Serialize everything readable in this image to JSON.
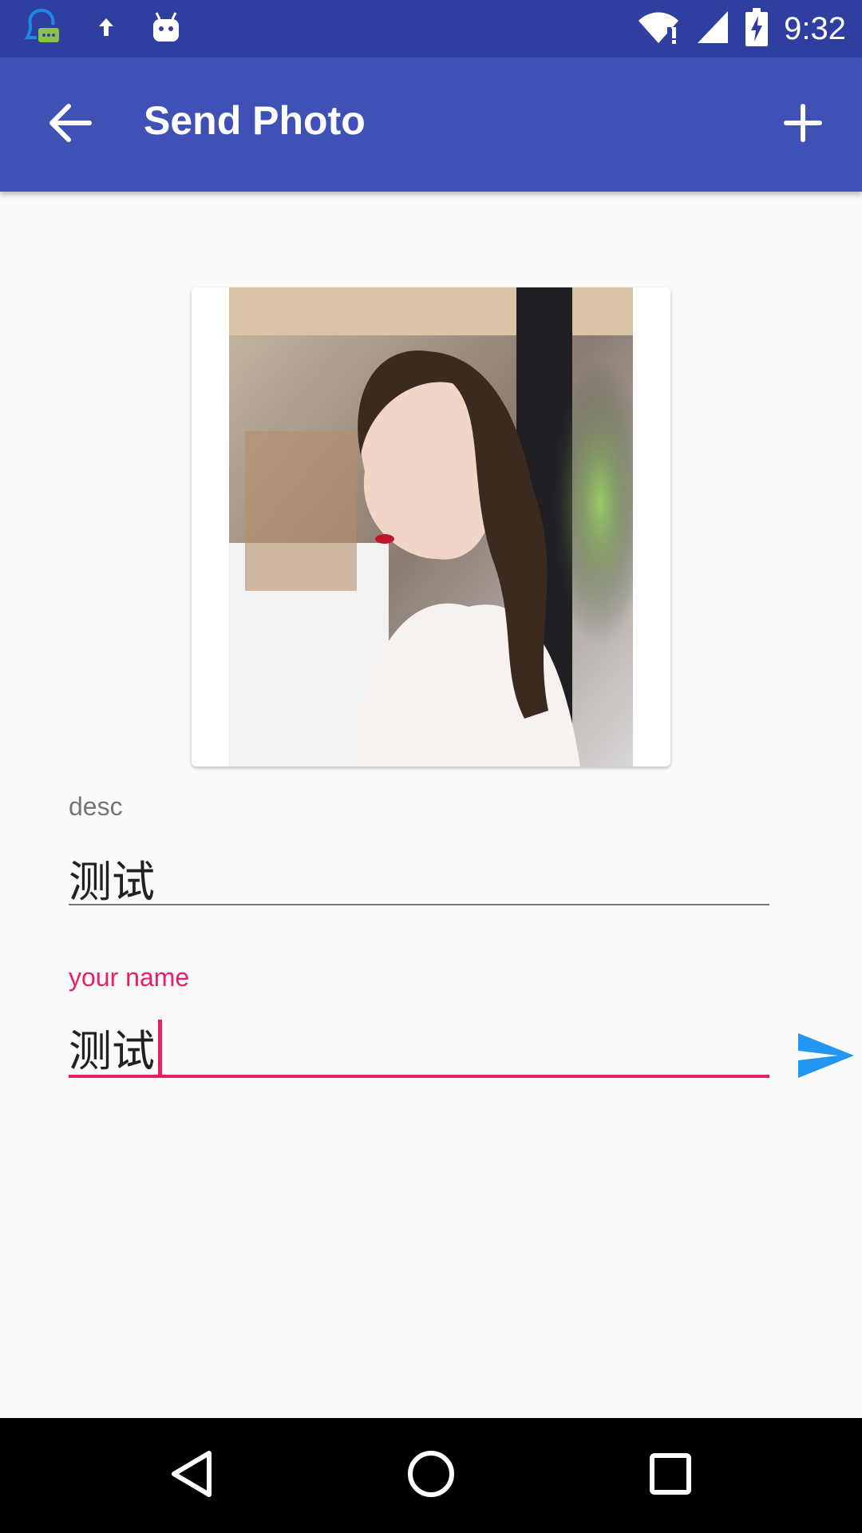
{
  "status_bar": {
    "time": "9:32",
    "icons": [
      "chat-app-icon",
      "upload-arrow-icon",
      "android-robot-icon",
      "wifi-icon",
      "cell-signal-icon",
      "battery-charging-icon"
    ]
  },
  "app_bar": {
    "title": "Send Photo",
    "back_icon": "arrow-back-icon",
    "add_icon": "plus-icon"
  },
  "form": {
    "desc": {
      "label": "desc",
      "value": "测试"
    },
    "name": {
      "label": "your name",
      "value": "测试"
    },
    "send_icon": "send-icon"
  },
  "nav_bar": {
    "icons": [
      "back-triangle-icon",
      "home-circle-icon",
      "recents-square-icon"
    ]
  },
  "colors": {
    "status_bar": "#303f9f",
    "primary": "#3f51b5",
    "accent": "#e91e63",
    "send_icon": "#2196f3",
    "background": "#fafafa"
  }
}
